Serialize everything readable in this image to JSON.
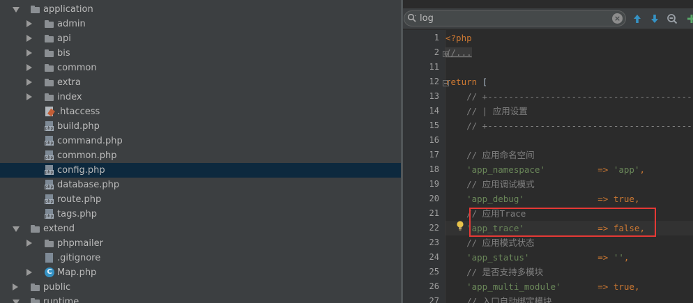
{
  "tree": {
    "items": [
      {
        "label": "application",
        "kind": "folder",
        "arrow": "down",
        "depth": 0
      },
      {
        "label": "admin",
        "kind": "folder",
        "arrow": "right",
        "depth": 1
      },
      {
        "label": "api",
        "kind": "folder",
        "arrow": "right",
        "depth": 1
      },
      {
        "label": "bis",
        "kind": "folder",
        "arrow": "right",
        "depth": 1
      },
      {
        "label": "common",
        "kind": "folder",
        "arrow": "right",
        "depth": 1
      },
      {
        "label": "extra",
        "kind": "folder",
        "arrow": "right",
        "depth": 1
      },
      {
        "label": "index",
        "kind": "folder",
        "arrow": "right",
        "depth": 1
      },
      {
        "label": ".htaccess",
        "kind": "htaccess",
        "arrow": "none",
        "depth": 1
      },
      {
        "label": "build.php",
        "kind": "php",
        "arrow": "none",
        "depth": 1
      },
      {
        "label": "command.php",
        "kind": "php",
        "arrow": "none",
        "depth": 1
      },
      {
        "label": "common.php",
        "kind": "php",
        "arrow": "none",
        "depth": 1
      },
      {
        "label": "config.php",
        "kind": "php",
        "arrow": "none",
        "depth": 1,
        "selected": true
      },
      {
        "label": "database.php",
        "kind": "php",
        "arrow": "none",
        "depth": 1
      },
      {
        "label": "route.php",
        "kind": "php",
        "arrow": "none",
        "depth": 1
      },
      {
        "label": "tags.php",
        "kind": "php",
        "arrow": "none",
        "depth": 1
      },
      {
        "label": "extend",
        "kind": "folder",
        "arrow": "down",
        "depth": 0
      },
      {
        "label": "phpmailer",
        "kind": "folder",
        "arrow": "right",
        "depth": 1
      },
      {
        "label": ".gitignore",
        "kind": "blank",
        "arrow": "none",
        "depth": 1
      },
      {
        "label": "Map.php",
        "kind": "class",
        "arrow": "right",
        "depth": 1
      },
      {
        "label": "public",
        "kind": "folder",
        "arrow": "right",
        "depth": 0
      },
      {
        "label": "runtime",
        "kind": "folder",
        "arrow": "down",
        "depth": 0
      }
    ]
  },
  "search": {
    "value": "log",
    "clear_glyph": "×",
    "icons": [
      "search-icon",
      "clear-icon",
      "prev-occurrence-icon",
      "next-occurrence-icon",
      "find-all-icon",
      "add-icon"
    ]
  },
  "editor": {
    "lines": [
      {
        "num": "1",
        "tokens": [
          {
            "t": "<?php",
            "c": "tag"
          }
        ]
      },
      {
        "num": "2",
        "tokens": [
          {
            "t": "//...",
            "c": "fold"
          }
        ]
      },
      {
        "num": "11",
        "tokens": []
      },
      {
        "num": "12",
        "tokens": [
          {
            "t": "return",
            "c": "kw"
          },
          {
            "t": " [",
            "c": "pl"
          }
        ]
      },
      {
        "num": "13",
        "tokens": [
          {
            "t": "    // +-----------------------------------------",
            "c": "cm"
          }
        ]
      },
      {
        "num": "14",
        "tokens": [
          {
            "t": "    // | 应用设置",
            "c": "cm"
          }
        ]
      },
      {
        "num": "15",
        "tokens": [
          {
            "t": "    // +-----------------------------------------",
            "c": "cm"
          }
        ]
      },
      {
        "num": "16",
        "tokens": []
      },
      {
        "num": "17",
        "tokens": [
          {
            "t": "    // 应用命名空间",
            "c": "cm"
          }
        ]
      },
      {
        "num": "18",
        "tokens": [
          {
            "t": "    'app_namespace'",
            "c": "str"
          },
          {
            "t": "          => ",
            "c": "kw"
          },
          {
            "t": "'app'",
            "c": "str"
          },
          {
            "t": ",",
            "c": "kw"
          }
        ]
      },
      {
        "num": "19",
        "tokens": [
          {
            "t": "    // 应用调试模式",
            "c": "cm"
          }
        ]
      },
      {
        "num": "20",
        "tokens": [
          {
            "t": "    'app_debug'",
            "c": "str"
          },
          {
            "t": "              => ",
            "c": "kw"
          },
          {
            "t": "true",
            "c": "kw"
          },
          {
            "t": ",",
            "c": "kw"
          }
        ]
      },
      {
        "num": "21",
        "tokens": [
          {
            "t": "    // 应用Trace",
            "c": "cm"
          }
        ]
      },
      {
        "num": "22",
        "tokens": [
          {
            "t": "    'app_trace'",
            "c": "str"
          },
          {
            "t": "              => ",
            "c": "kw"
          },
          {
            "t": "false",
            "c": "kw"
          },
          {
            "t": ",",
            "c": "kw"
          }
        ],
        "current": true
      },
      {
        "num": "23",
        "tokens": [
          {
            "t": "    // 应用模式状态",
            "c": "cm"
          }
        ]
      },
      {
        "num": "24",
        "tokens": [
          {
            "t": "    'app_status'",
            "c": "str"
          },
          {
            "t": "             => ",
            "c": "kw"
          },
          {
            "t": "''",
            "c": "str"
          },
          {
            "t": ",",
            "c": "kw"
          }
        ]
      },
      {
        "num": "25",
        "tokens": [
          {
            "t": "    // 是否支持多模块",
            "c": "cm"
          }
        ]
      },
      {
        "num": "26",
        "tokens": [
          {
            "t": "    'app_multi_module'",
            "c": "str"
          },
          {
            "t": "       => ",
            "c": "kw"
          },
          {
            "t": "true",
            "c": "kw"
          },
          {
            "t": ",",
            "c": "kw"
          }
        ]
      },
      {
        "num": "27",
        "tokens": [
          {
            "t": "    // 入口自动绑定模块",
            "c": "cm"
          }
        ]
      }
    ]
  },
  "colors": {
    "tree_bg": "#3c3f41",
    "selection": "#0d293e",
    "editor_bg": "#2b2b2b",
    "highlight_box": "#e53935",
    "keyword": "#cc7832",
    "string": "#6a8759",
    "comment": "#808080"
  }
}
